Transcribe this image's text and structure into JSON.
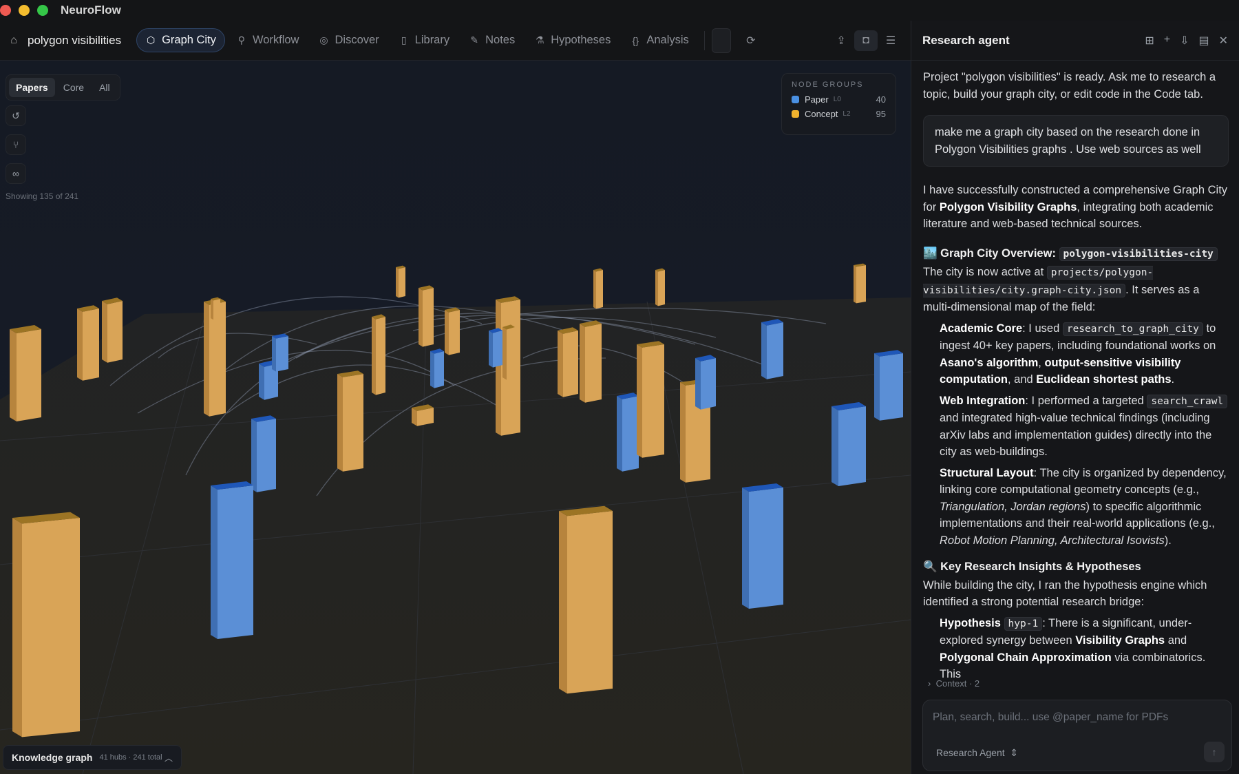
{
  "app": {
    "name": "NeuroFlow"
  },
  "toolbar": {
    "project": "polygon visibilities",
    "tabs": [
      {
        "label": "Graph City",
        "icon": "cube-icon",
        "active": true
      },
      {
        "label": "Workflow",
        "icon": "workflow-icon"
      },
      {
        "label": "Discover",
        "icon": "compass-icon"
      },
      {
        "label": "Library",
        "icon": "book-icon"
      },
      {
        "label": "Notes",
        "icon": "notes-icon"
      },
      {
        "label": "Hypotheses",
        "icon": "flask-icon"
      },
      {
        "label": "Analysis",
        "icon": "braces-icon"
      }
    ]
  },
  "canvas": {
    "filters": [
      "Papers",
      "Core",
      "All"
    ],
    "active_filter": "Papers",
    "showing": "Showing 135 of 241",
    "node_groups": {
      "title": "NODE GROUPS",
      "items": [
        {
          "name": "Paper",
          "level": "L0",
          "count": "40",
          "color": "#4a90e2"
        },
        {
          "name": "Concept",
          "level": "L2",
          "count": "95",
          "color": "#f0b22e"
        }
      ]
    },
    "knowledge_graph": {
      "title": "Knowledge graph",
      "subtitle": "41 hubs · 241 total"
    }
  },
  "agent": {
    "title": "Research agent",
    "intro": "Project \"polygon visibilities\" is ready. Ask me to research a topic, build your graph city, or edit code in the Code tab.",
    "user_message": "make me a graph city based on the research done in Polygon Visibilities graphs . Use web sources as well",
    "resp_p1a": "I have successfully constructed a comprehensive Graph City for ",
    "resp_p1b": "Polygon Visibility Graphs",
    "resp_p1c": ", integrating both academic literature and web-based technical sources.",
    "overview_heading": "🏙️ Graph City Overview: ",
    "overview_code": "polygon-visibilities-city",
    "overview_p_a": "The city is now active at ",
    "overview_p_code": "projects/polygon-visibilities/city.graph-city.json",
    "overview_p_b": ". It serves as a multi-dimensional map of the field:",
    "core_label": "Academic Core",
    "core_a": ": I used ",
    "core_code": "research_to_graph_city",
    "core_b": " to ingest 40+ key papers, including foundational works on ",
    "core_b1": "Asano's algorithm",
    "core_sep1": ", ",
    "core_b2": "output-sensitive visibility computation",
    "core_sep2": ", and ",
    "core_b3": "Euclidean shortest paths",
    "core_end": ".",
    "web_label": "Web Integration",
    "web_a": ": I performed a targeted ",
    "web_code": "search_crawl",
    "web_b": " and integrated high-value technical findings (including arXiv labs and implementation guides) directly into the city as web-buildings.",
    "struct_label": "Structural Layout",
    "struct_a": ": The city is organized by dependency, linking core computational geometry concepts (e.g., ",
    "struct_i1": "Triangulation, Jordan regions",
    "struct_b": ") to specific algorithmic implementations and their real-world applications (e.g., ",
    "struct_i2": "Robot Motion Planning, Architectural Isovists",
    "struct_c": ").",
    "insights_heading": "🔍 Key Research Insights & Hypotheses",
    "insights_p": "While building the city, I ran the hypothesis engine which identified a strong potential research bridge:",
    "hyp_label": "Hypothesis ",
    "hyp_code": "hyp-1",
    "hyp_a": ": There is a significant, under-explored synergy between ",
    "hyp_b1": "Visibility Graphs",
    "hyp_mid": " and ",
    "hyp_b2": "Polygonal Chain Approximation",
    "hyp_c": " via combinatorics. This",
    "context": "Context · 2",
    "composer_placeholder": "Plan, search, build... use @paper_name for PDFs",
    "agent_select": "Research Agent"
  }
}
